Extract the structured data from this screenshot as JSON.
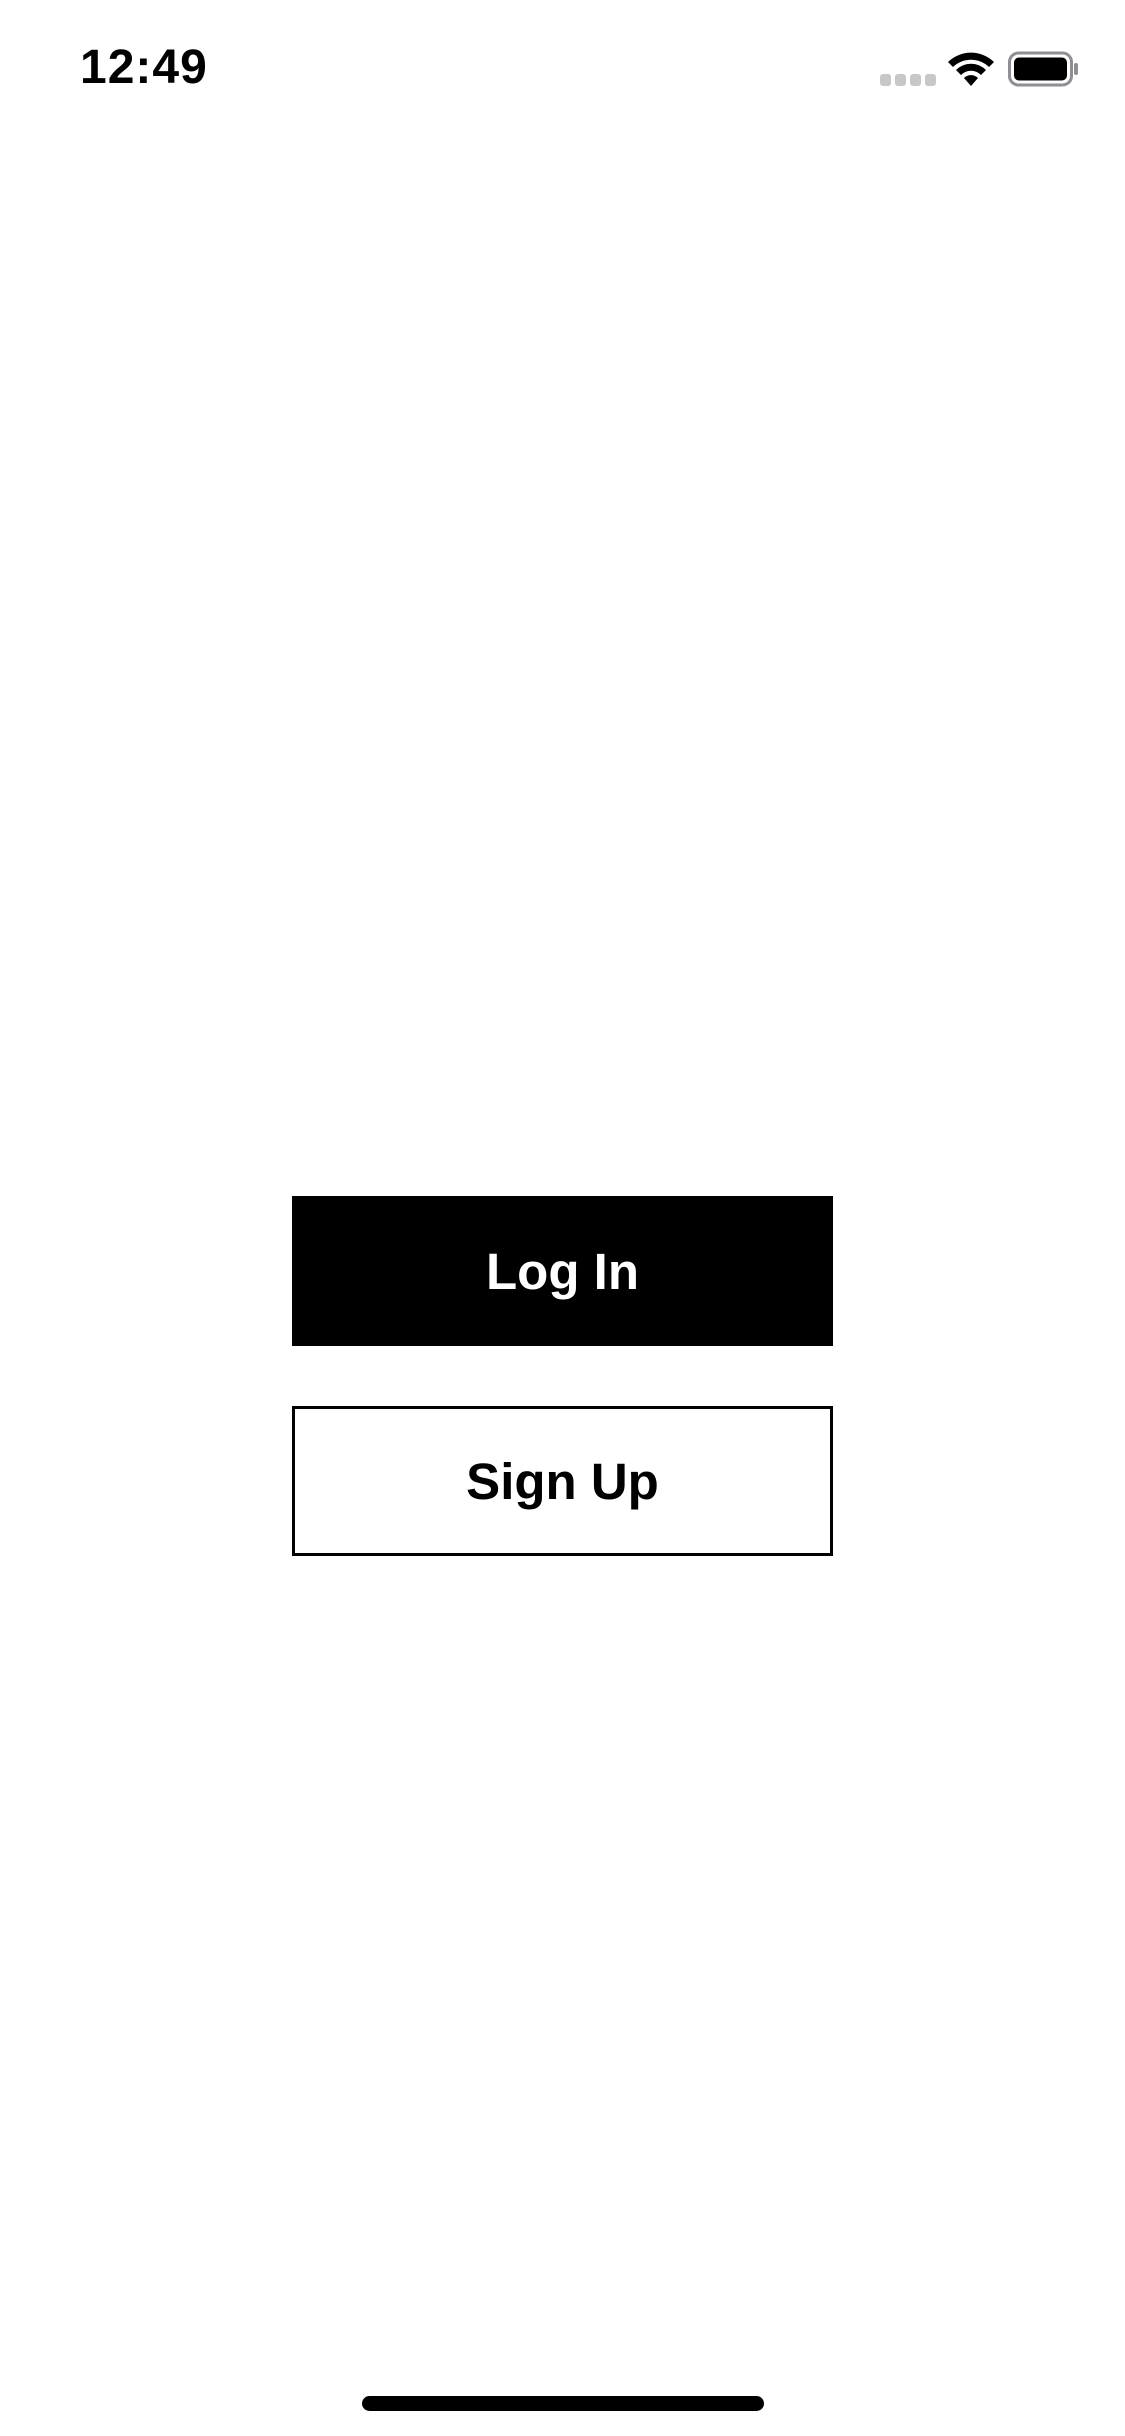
{
  "status_bar": {
    "time": "12:49",
    "icons": [
      "cellular-signal-icon",
      "wifi-icon",
      "battery-icon"
    ]
  },
  "auth": {
    "login_label": "Log In",
    "signup_label": "Sign Up"
  },
  "colors": {
    "background": "#ffffff",
    "primary": "#000000",
    "signal_inactive": "#c7c7c7"
  }
}
